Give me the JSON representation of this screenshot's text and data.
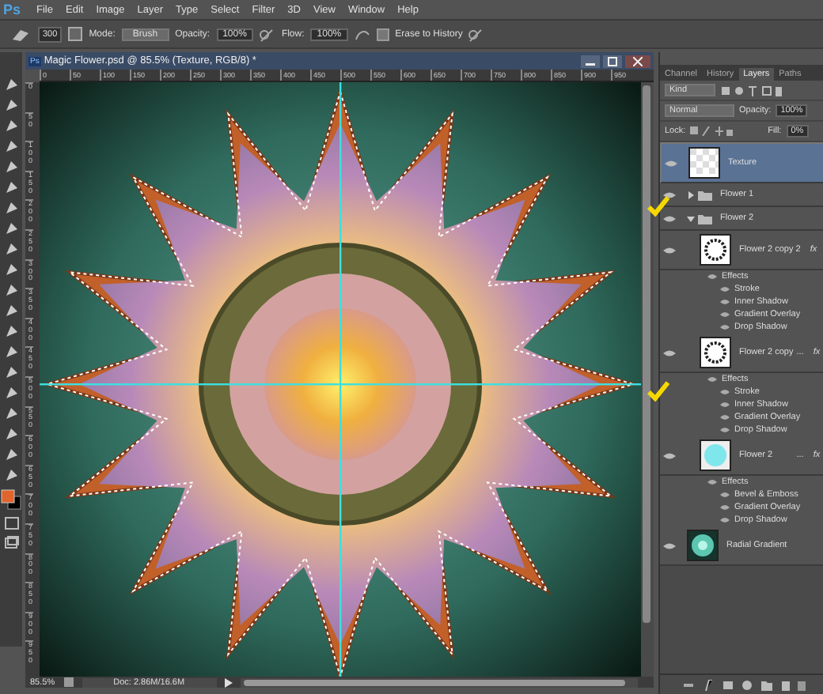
{
  "app_logo": "Ps",
  "menu": [
    "File",
    "Edit",
    "Image",
    "Layer",
    "Type",
    "Select",
    "Filter",
    "3D",
    "View",
    "Window",
    "Help"
  ],
  "options_bar": {
    "brush_size": "300",
    "mode_label": "Mode:",
    "mode": "Brush",
    "opacity_label": "Opacity:",
    "opacity": "100%",
    "flow_label": "Flow:",
    "flow": "100%",
    "erase_to_history": {
      "label": "Erase to History",
      "checked": false
    }
  },
  "document": {
    "logo": "Ps",
    "title": "Magic Flower.psd @ 85.5% (Texture, RGB/8) *",
    "ruler_h": [
      "0",
      "50",
      "100",
      "150",
      "200",
      "250",
      "300",
      "350",
      "400",
      "450",
      "500",
      "550",
      "600",
      "650",
      "700",
      "750",
      "800",
      "850",
      "900",
      "950"
    ],
    "ruler_v": [
      "0",
      "50",
      "100",
      "150",
      "200",
      "250",
      "300",
      "350",
      "400",
      "450",
      "500",
      "550",
      "600",
      "650",
      "700",
      "750",
      "800",
      "850",
      "900",
      "950"
    ],
    "zoom": "85.5%",
    "doc_size": "Doc: 2.86M/16.6M"
  },
  "panel": {
    "tabs": [
      {
        "label": "Channel",
        "selected": false
      },
      {
        "label": "History",
        "selected": false
      },
      {
        "label": "Layers",
        "selected": true
      },
      {
        "label": "Paths",
        "selected": false
      }
    ],
    "filter": "Kind",
    "blend_mode": "Normal",
    "opacity_label": "Opacity:",
    "opacity": "100%",
    "lock_label": "Lock:",
    "fill_label": "Fill:",
    "fill": "0%",
    "layers": [
      {
        "kind": "layer",
        "name": "Texture",
        "thumbnail": {
          "kind": "checker"
        },
        "selected": true,
        "visible": true
      },
      {
        "kind": "group",
        "name": "Flower 1",
        "expanded": false,
        "selected": false,
        "visible": true
      },
      {
        "kind": "group",
        "name": "Flower 2",
        "expanded": true,
        "selected": false,
        "visible": true,
        "children": [
          {
            "kind": "layer",
            "name": "Flower 2  copy 2",
            "thumbnail": {
              "kind": "ring"
            },
            "fx": "fx",
            "selected": false,
            "visible": true,
            "effects_label": "Effects",
            "effects": [
              "Stroke",
              "Inner Shadow",
              "Gradient Overlay",
              "Drop Shadow"
            ]
          },
          {
            "kind": "layer",
            "name": "Flower 2  copy",
            "ellipsis": "...",
            "thumbnail": {
              "kind": "ring"
            },
            "fx": "fx",
            "selected": false,
            "visible": true,
            "effects_label": "Effects",
            "effects": [
              "Stroke",
              "Inner Shadow",
              "Gradient Overlay",
              "Drop Shadow"
            ]
          },
          {
            "kind": "layer",
            "name": "Flower 2",
            "ellipsis": "...",
            "thumbnail": {
              "kind": "cyan"
            },
            "fx": "fx",
            "selected": false,
            "visible": true,
            "effects_label": "Effects",
            "effects": [
              "Bevel & Emboss",
              "Gradient Overlay",
              "Drop Shadow"
            ]
          }
        ]
      },
      {
        "kind": "layer",
        "name": "Radial Gradient",
        "thumbnail": {
          "kind": "radial"
        },
        "selected": false,
        "visible": true
      }
    ]
  }
}
